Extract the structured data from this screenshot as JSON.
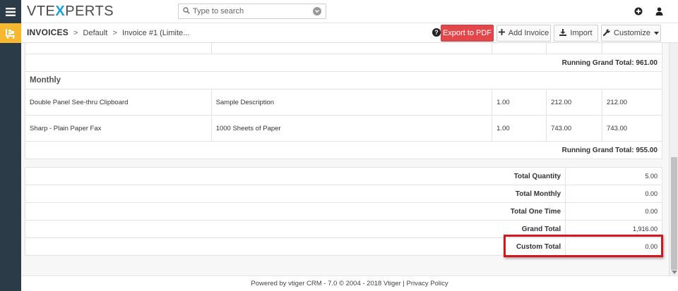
{
  "brand": {
    "logo_left": "VTE",
    "logo_x": "X",
    "logo_right": "PERTS"
  },
  "search": {
    "placeholder": "Type to search"
  },
  "breadcrumb": {
    "module": "INVOICES",
    "sep1": ">",
    "view": "Default",
    "sep2": ">",
    "record": "Invoice #1 (Limite..."
  },
  "toolbar": {
    "help": "?",
    "export_label": "Export to PDF",
    "add_label": "Add Invoice",
    "import_label": "Import",
    "customize_label": "Customize"
  },
  "items": {
    "running_1": "Running Grand Total: 961.00",
    "section_title": "Monthly",
    "rows": [
      {
        "name": "Double Panel See-thru Clipboard",
        "description": "Sample Description",
        "qty": "1.00",
        "price": "212.00",
        "total": "212.00"
      },
      {
        "name": "Sharp - Plain Paper Fax",
        "description": "1000 Sheets of Paper",
        "qty": "1.00",
        "price": "743.00",
        "total": "743.00"
      }
    ],
    "running_2": "Running Grand Total: 955.00"
  },
  "totals": [
    {
      "label": "Total Quantity",
      "value": "5.00"
    },
    {
      "label": "Total Monthly",
      "value": "0.00"
    },
    {
      "label": "Total One Time",
      "value": "0.00"
    },
    {
      "label": "Grand Total",
      "value": "1,916.00"
    },
    {
      "label": "Custom Total",
      "value": "0.00"
    }
  ],
  "footer": {
    "powered": "Powered by vtiger CRM - 7.0  © 2004 - 2018  Vtiger |  Privacy Policy"
  },
  "colors": {
    "rail": "#2c3b48",
    "accent_yellow": "#f5b82e",
    "export_red": "#e2474b",
    "highlight_red": "#d7151b",
    "logo_blue": "#1aa0d8"
  },
  "icons": {
    "menu": "hamburger-icon",
    "cart": "cart-icon",
    "search": "search-icon",
    "search_toggle": "chevron-circle-icon",
    "add": "plus-circle-icon",
    "user": "user-icon",
    "help": "question-circle-icon",
    "add_invoice": "plus-icon",
    "import": "download-icon",
    "customize": "wrench-icon",
    "dropdown": "caret-down-icon"
  }
}
